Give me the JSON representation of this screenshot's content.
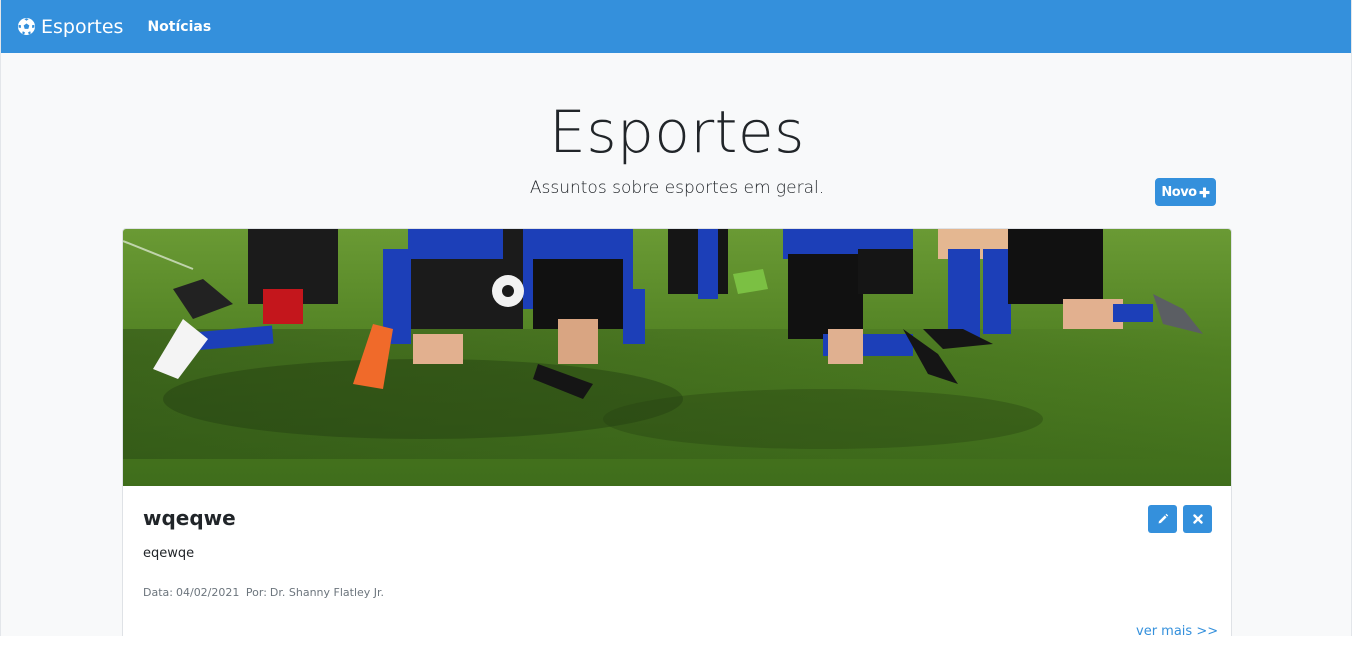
{
  "navbar": {
    "brand_label": "Esportes",
    "brand_icon": "soccer-ball-icon",
    "links": [
      {
        "label": "Notícias"
      }
    ],
    "background_color": "#3490dc"
  },
  "hero": {
    "title": "Esportes",
    "subtitle": "Assuntos sobre esportes em geral.",
    "new_button_label": "Novo",
    "new_button_icon": "plus-icon"
  },
  "posts": [
    {
      "image": "soccer-players-kneeling-on-grass",
      "title": "wqeqwe",
      "body": "eqewqe",
      "date_label": "Data:",
      "date": "04/02/2021",
      "author_label": "Por:",
      "author": "Dr. Shanny Flatley Jr.",
      "edit_icon": "pencil-icon",
      "delete_icon": "close-icon",
      "more_label": "ver mais >>"
    }
  ],
  "colors": {
    "accent": "#3490dc",
    "page_background": "#f8f9fa",
    "meta_text": "#6c757d"
  }
}
